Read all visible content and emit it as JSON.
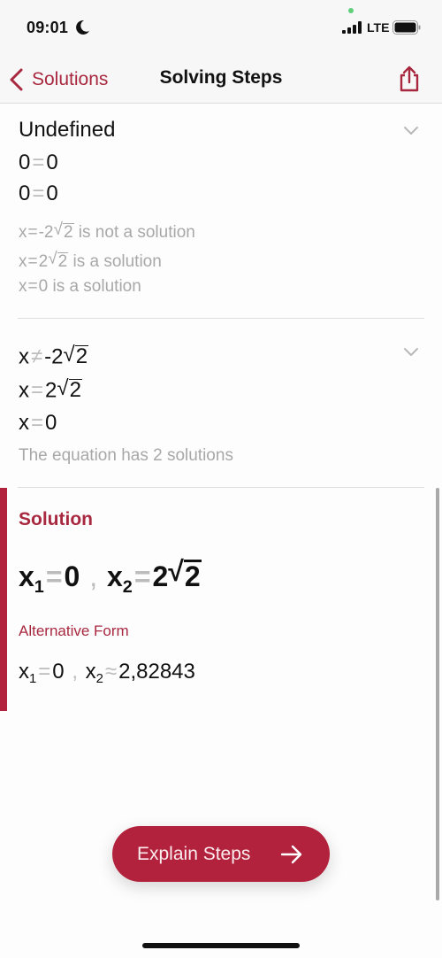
{
  "status_bar": {
    "time": "09:01",
    "moon_icon": "moon-icon",
    "network": "LTE",
    "signal_icon": "cellular-signal-icon",
    "battery_icon": "battery-icon"
  },
  "nav": {
    "back_label": "Solutions",
    "title": "Solving Steps",
    "share_icon": "share-icon"
  },
  "steps": [
    {
      "lines": [
        {
          "text": "Undefined"
        },
        {
          "lhs": "0",
          "op": "=",
          "rhs": "0"
        },
        {
          "lhs": "0",
          "op": "=",
          "rhs": "0"
        }
      ],
      "notes": [
        {
          "lhs": "x",
          "op": "=",
          "coef": "-2",
          "radicand": "2",
          "suffix": " is not a solution"
        },
        {
          "lhs": "x",
          "op": "=",
          "coef": "2",
          "radicand": "2",
          "suffix": " is a solution"
        },
        {
          "lhs": "x",
          "op": "=",
          "rhs": "0",
          "suffix": " is a solution"
        }
      ]
    },
    {
      "lines": [
        {
          "lhs": "x",
          "op": "≠",
          "coef": "-2",
          "radicand": "2"
        },
        {
          "lhs": "x",
          "op": "=",
          "coef": "2",
          "radicand": "2"
        },
        {
          "lhs": "x",
          "op": "=",
          "rhs": "0"
        }
      ],
      "note": "The equation has 2 solutions"
    }
  ],
  "solution": {
    "title": "Solution",
    "main": {
      "x1_var": "x",
      "x1_sub": "1",
      "x1_op": "=",
      "x1_val": "0",
      "sep": ",",
      "x2_var": "x",
      "x2_sub": "2",
      "x2_op": "=",
      "x2_coef": "2",
      "x2_radicand": "2"
    },
    "alt_label": "Alternative Form",
    "alt": {
      "x1_var": "x",
      "x1_sub": "1",
      "x1_op": "=",
      "x1_val": "0",
      "sep": ",",
      "x2_var": "x",
      "x2_sub": "2",
      "x2_op": "≈",
      "x2_val": "2,82843"
    }
  },
  "explain_button": {
    "label": "Explain Steps",
    "icon": "arrow-right-icon"
  },
  "colors": {
    "accent": "#b3223d",
    "accent_text": "#a8283f",
    "muted_text": "#a8a8a8"
  }
}
